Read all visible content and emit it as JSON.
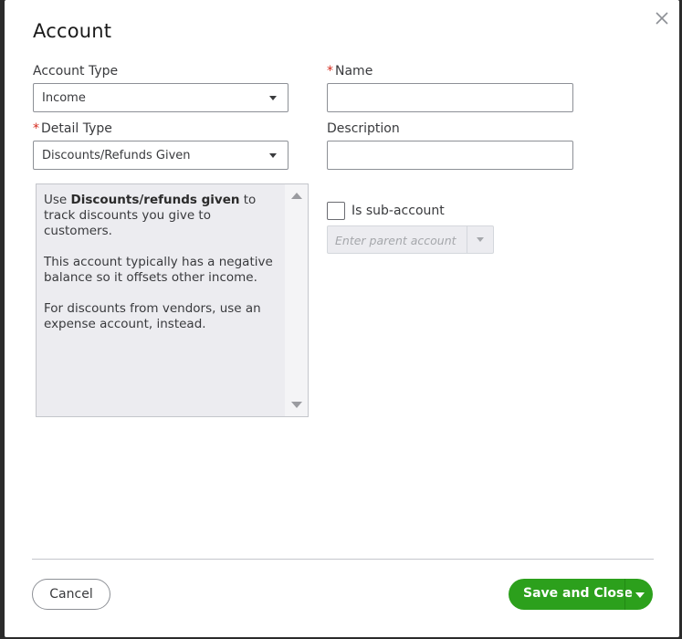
{
  "dialog": {
    "title": "Account",
    "close_icon": "close-icon"
  },
  "account_type": {
    "label": "Account Type",
    "value": "Income"
  },
  "name": {
    "required_mark": "*",
    "label": "Name",
    "value": ""
  },
  "detail_type": {
    "required_mark": "*",
    "label": "Detail Type",
    "value": "Discounts/Refunds Given"
  },
  "description": {
    "label": "Description",
    "value": ""
  },
  "help": {
    "p1_prefix": "Use ",
    "p1_bold": "Discounts/refunds given",
    "p1_suffix": " to track discounts you give to customers.",
    "p2": "This account typically has a negative balance so it offsets other income.",
    "p3": "For discounts from vendors, use an expense account, instead."
  },
  "sub_account": {
    "label": "Is sub-account",
    "checked": false,
    "parent_placeholder": "Enter parent account"
  },
  "footer": {
    "cancel_label": "Cancel",
    "save_label": "Save and Close"
  },
  "colors": {
    "primary_button": "#2ca01c",
    "required": "#d52b1e",
    "help_background": "#ececf0"
  }
}
